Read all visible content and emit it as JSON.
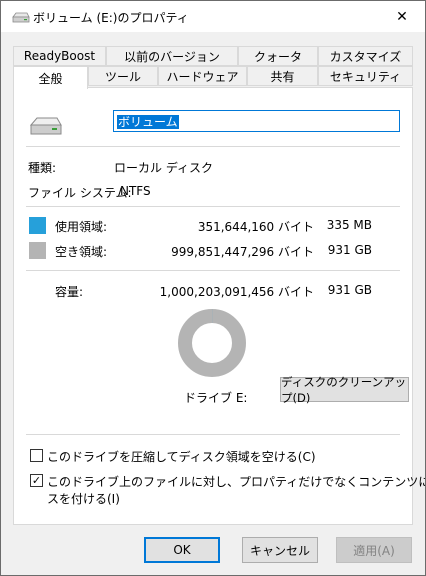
{
  "window": {
    "title": "ボリューム (E:)のプロパティ",
    "close_glyph": "✕"
  },
  "tabs_row1": [
    "ReadyBoost",
    "以前のバージョン",
    "クォータ",
    "カスタマイズ"
  ],
  "tabs_row2": [
    "全般",
    "ツール",
    "ハードウェア",
    "共有",
    "セキュリティ"
  ],
  "active_tab": "全般",
  "general": {
    "volume_name": "ボリューム",
    "type_label": "種類:",
    "type_value": "ローカル ディスク",
    "fs_label": "ファイル システム:",
    "fs_value": "NTFS",
    "used_label": "使用領域:",
    "used_bytes": "351,644,160 バイト",
    "used_size": "335 MB",
    "free_label": "空き領域:",
    "free_bytes": "999,851,447,296 バイト",
    "free_size": "931 GB",
    "capacity_label": "容量:",
    "capacity_bytes": "1,000,203,091,456 バイト",
    "capacity_size": "931 GB",
    "drive_label": "ドライブ E:",
    "cleanup_button": "ディスクのクリーンアップ(D)",
    "used_fraction": 0.00035,
    "colors": {
      "used": "#26a0da",
      "free": "#b4b4b4"
    },
    "compress_label": "このドライブを圧縮してディスク領域を空ける(C)",
    "compress_checked": false,
    "index_label_line1": "このドライブ上のファイルに対し、プロパティだけでなくコンテンツにもインデック",
    "index_label_line2": "スを付ける(I)",
    "index_checked": true,
    "check_glyph": "✓"
  },
  "buttons": {
    "ok": "OK",
    "cancel": "キャンセル",
    "apply": "適用(A)"
  }
}
